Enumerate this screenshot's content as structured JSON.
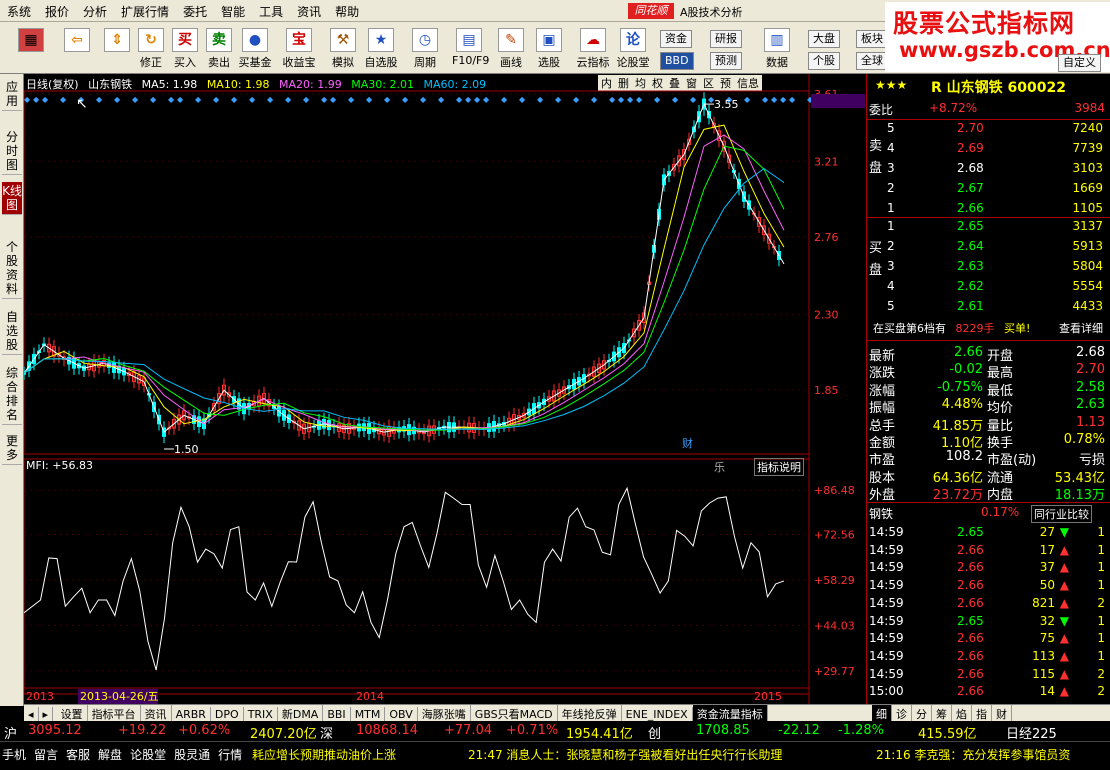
{
  "menu": [
    "系统",
    "报价",
    "分析",
    "扩展行情",
    "委托",
    "智能",
    "工具",
    "资讯",
    "帮助"
  ],
  "brand": "同花顺",
  "subtitle": "A股技术分析",
  "watermark": {
    "line1": "股票公式指标网",
    "line2": "www.gszb.com.cn"
  },
  "toolbar": {
    "buttons": [
      "修正",
      "买入",
      "卖出",
      "买基金",
      "收益宝",
      "模拟",
      "自选股",
      "周期",
      "F10/F9",
      "画线",
      "选股",
      "云指标",
      "论股堂",
      "数据"
    ],
    "right": [
      "资金",
      "研报",
      "大盘",
      "板块",
      "BBD",
      "预测",
      "个股",
      "全球",
      "自定义"
    ]
  },
  "leftbar": [
    "应用",
    "分时图",
    "K线图",
    "个股资料",
    "自选股",
    "综合排名",
    "更多"
  ],
  "kline": {
    "title": "日线(复权)",
    "name": "山东钢铁",
    "ma": [
      {
        "label": "MA5: 1.98",
        "color": "#ffffff"
      },
      {
        "label": "MA10: 1.98",
        "color": "#ffff00"
      },
      {
        "label": "MA20: 1.99",
        "color": "#ff60ff"
      },
      {
        "label": "MA30: 2.01",
        "color": "#00ff00"
      },
      {
        "label": "MA60: 2.09",
        "color": "#00c0ff"
      }
    ],
    "buttons": [
      "内",
      "删",
      "均",
      "权",
      "叠",
      "窗",
      "区",
      "预",
      "信息"
    ],
    "price_ticks": [
      "3.61",
      "3.21",
      "2.76",
      "2.30",
      "1.85"
    ],
    "high": "3.55",
    "low": "1.50",
    "fin_label": "财"
  },
  "mfi": {
    "title": "MFI: +56.83",
    "ticks": [
      "+86.48",
      "+72.56",
      "+58.29",
      "+44.03",
      "+29.77"
    ],
    "btn1": "乐",
    "btn2": "指标说明"
  },
  "xaxis": {
    "labels": [
      "2013",
      "2014",
      "2015"
    ],
    "cursor": "2013-04-26/五"
  },
  "chart_data": {
    "type": "line",
    "price_series": [
      1.95,
      2.12,
      2.04,
      1.98,
      2.01,
      1.96,
      1.9,
      1.6,
      1.7,
      1.65,
      1.85,
      1.74,
      1.8,
      1.7,
      1.62,
      1.65,
      1.62,
      1.63,
      1.6,
      1.62,
      1.6,
      1.63,
      1.63,
      1.62,
      1.65,
      1.7,
      1.78,
      1.85,
      1.92,
      2.0,
      2.1,
      2.28,
      3.1,
      3.25,
      3.55,
      3.3,
      3.0,
      2.8,
      2.6
    ],
    "mfi_values": [
      48,
      52,
      65,
      53,
      48,
      52,
      58,
      55,
      30,
      70,
      75,
      68,
      62,
      75,
      52,
      50,
      64,
      78,
      70,
      58,
      48,
      45,
      52,
      75,
      69,
      73,
      84,
      82,
      56,
      58,
      52,
      45,
      68,
      78,
      75,
      67,
      82,
      76,
      60,
      58,
      72,
      80,
      84,
      72,
      70,
      53,
      58
    ],
    "ylim_price": [
      1.5,
      3.61
    ],
    "ylim_mfi": [
      25,
      90
    ]
  },
  "stock": {
    "code": "600022",
    "name": "山东钢铁"
  },
  "webi": {
    "label": "委比",
    "pct": "+8.72%",
    "val": "3984"
  },
  "sell_label": "卖盘",
  "buy_label": "买盘",
  "asks": [
    {
      "n": "5",
      "p": "2.70",
      "v": "7240"
    },
    {
      "n": "4",
      "p": "2.69",
      "v": "7739"
    },
    {
      "n": "3",
      "p": "2.68",
      "v": "3103"
    },
    {
      "n": "2",
      "p": "2.67",
      "v": "1669"
    },
    {
      "n": "1",
      "p": "2.66",
      "v": "1105"
    }
  ],
  "bids": [
    {
      "n": "1",
      "p": "2.65",
      "v": "3137"
    },
    {
      "n": "2",
      "p": "2.64",
      "v": "5913"
    },
    {
      "n": "3",
      "p": "2.63",
      "v": "5804"
    },
    {
      "n": "4",
      "p": "2.62",
      "v": "5554"
    },
    {
      "n": "5",
      "p": "2.61",
      "v": "4433"
    }
  ],
  "notice": {
    "text": "在买盘第6档有",
    "v": "8229手",
    "act": "买单!",
    "btn": "查看详细"
  },
  "quote": [
    {
      "l1": "最新",
      "v1": "2.66",
      "c1": "#00ff00",
      "l2": "开盘",
      "v2": "2.68",
      "c2": "#ffffff"
    },
    {
      "l1": "涨跌",
      "v1": "-0.02",
      "c1": "#00ff00",
      "l2": "最高",
      "v2": "2.70",
      "c2": "#ff3030"
    },
    {
      "l1": "涨幅",
      "v1": "-0.75%",
      "c1": "#00ff00",
      "l2": "最低",
      "v2": "2.58",
      "c2": "#00ff00"
    },
    {
      "l1": "振幅",
      "v1": "4.48%",
      "c1": "#ffff00",
      "l2": "均价",
      "v2": "2.63",
      "c2": "#00ff00"
    },
    {
      "l1": "总手",
      "v1": "41.85万",
      "c1": "#ffff00",
      "l2": "量比",
      "v2": "1.13",
      "c2": "#ff3030"
    },
    {
      "l1": "金额",
      "v1": "1.10亿",
      "c1": "#ffff00",
      "l2": "换手",
      "v2": "0.78%",
      "c2": "#ffff00"
    },
    {
      "l1": "市盈",
      "v1": "108.2",
      "c1": "#ffffff",
      "l2": "市盈(动)",
      "v2": "亏损",
      "c2": "#ffffff"
    },
    {
      "l1": "股本",
      "v1": "64.36亿",
      "c1": "#ffff00",
      "l2": "流通",
      "v2": "53.43亿",
      "c2": "#ffff00"
    },
    {
      "l1": "外盘",
      "v1": "23.72万",
      "c1": "#ff3030",
      "l2": "内盘",
      "v2": "18.13万",
      "c2": "#00ff00"
    }
  ],
  "industry": {
    "label": "钢铁",
    "pct": "0.17%",
    "btn": "同行业比较"
  },
  "ticks": [
    {
      "t": "14:59",
      "p": "2.65",
      "v": "27",
      "d": "down",
      "n": "1"
    },
    {
      "t": "14:59",
      "p": "2.66",
      "v": "17",
      "d": "up",
      "n": "1"
    },
    {
      "t": "14:59",
      "p": "2.66",
      "v": "37",
      "d": "up",
      "n": "1"
    },
    {
      "t": "14:59",
      "p": "2.66",
      "v": "50",
      "d": "up",
      "n": "1"
    },
    {
      "t": "14:59",
      "p": "2.66",
      "v": "821",
      "d": "up",
      "n": "2"
    },
    {
      "t": "14:59",
      "p": "2.65",
      "v": "32",
      "d": "down",
      "n": "1"
    },
    {
      "t": "14:59",
      "p": "2.66",
      "v": "75",
      "d": "up",
      "n": "1"
    },
    {
      "t": "14:59",
      "p": "2.66",
      "v": "113",
      "d": "up",
      "n": "1"
    },
    {
      "t": "14:59",
      "p": "2.66",
      "v": "115",
      "d": "up",
      "n": "2"
    },
    {
      "t": "15:00",
      "p": "2.66",
      "v": "14",
      "d": "up",
      "n": "2"
    }
  ],
  "bottom_tabs": [
    "设置",
    "指标平台",
    "资讯",
    "ARBR",
    "DPO",
    "TRIX",
    "新DMA",
    "BBI",
    "MTM",
    "OBV",
    "海豚张嘴",
    "GBS只看MACD",
    "年线抢反弹",
    "ENE_INDEX",
    "资金流量指标"
  ],
  "right_tabs": [
    "细",
    "诊",
    "分",
    "筹",
    "焰",
    "指",
    "财"
  ],
  "indices": {
    "sh": {
      "label": "沪",
      "v": "3095.12",
      "ch": "+19.22",
      "pct": "+0.62%",
      "amt": "2407.20亿"
    },
    "sz": {
      "label": "深",
      "v": "10868.14",
      "ch": "+77.04",
      "pct": "+0.71%",
      "amt": "1954.41亿"
    },
    "cy": {
      "label": "创",
      "v": "1708.85",
      "ch": "-22.12",
      "pct": "-1.28%",
      "amt": "415.59亿"
    },
    "nk": "日经225"
  },
  "statusbar": [
    "手机",
    "留言",
    "客服",
    "解盘",
    "论股堂",
    "股灵通",
    "行情"
  ],
  "news": [
    "耗应增长预期推动油价上涨",
    "21:47 消息人士：张晓慧和杨子强被看好出任央行行长助理",
    "21:16 李克强：充分发挥参事馆员资"
  ]
}
